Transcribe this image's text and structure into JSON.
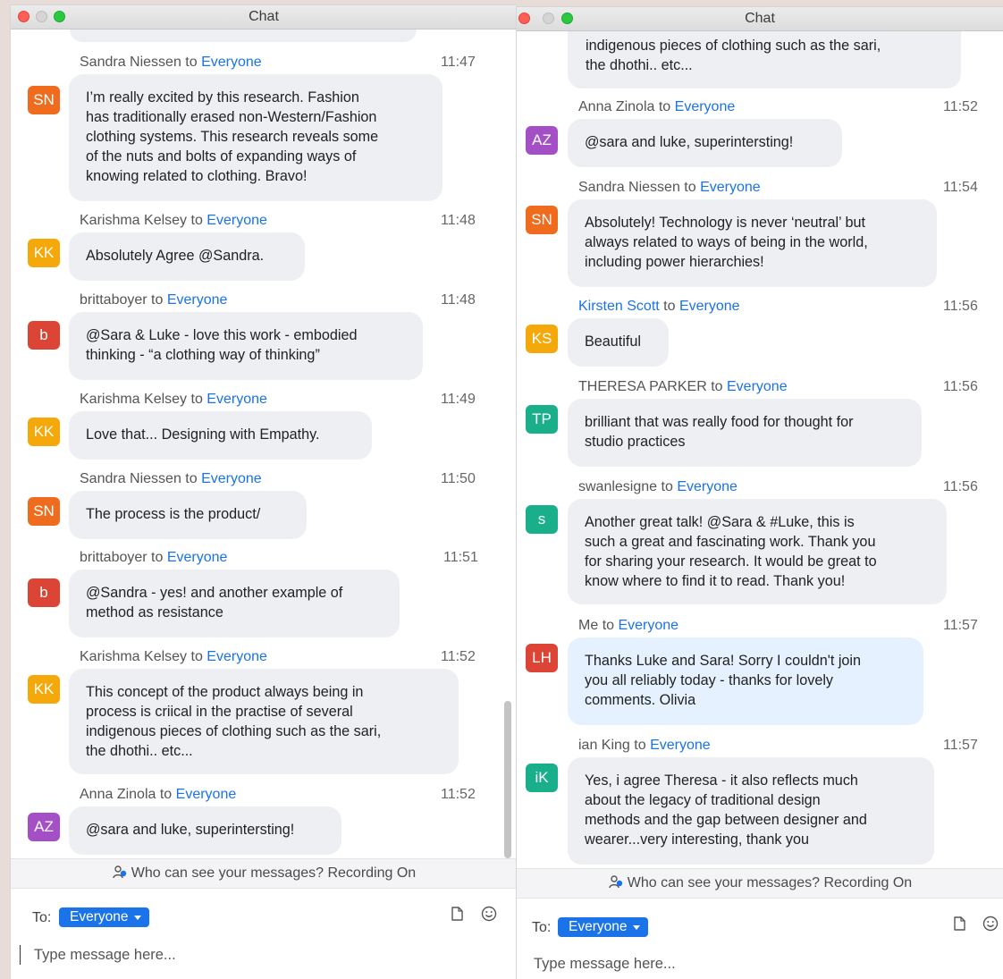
{
  "window_title": "Chat",
  "colors": {
    "orange": "#ef6c1e",
    "yellow": "#f5a80a",
    "red": "#dc4535",
    "purple": "#a54fc7",
    "teal": "#1aaf8b",
    "link_blue": "#1a73e8"
  },
  "left": {
    "messages": [
      {
        "sender": "Sandra Niessen",
        "to": "to",
        "recipient": "Everyone",
        "time": "11:47",
        "initials": "SN",
        "lines": [
          "I’m really excited by this research. Fashion",
          "has traditionally erased non-Western/Fashion",
          "clothing systems. This research reveals some",
          "of the nuts and bolts of expanding ways of",
          "knowing related to clothing. Bravo!"
        ]
      },
      {
        "sender": "Karishma Kelsey",
        "to": "to",
        "recipient": "Everyone",
        "time": "11:48",
        "initials": "KK",
        "lines": [
          "Absolutely Agree @Sandra."
        ]
      },
      {
        "sender": "brittaboyer",
        "to": "to",
        "recipient": "Everyone",
        "time": "11:48",
        "initials": "b",
        "lines": [
          "@Sara & Luke  - love this work - embodied",
          "thinking - “a clothing way of thinking”"
        ]
      },
      {
        "sender": "Karishma Kelsey",
        "to": "to",
        "recipient": "Everyone",
        "time": "11:49",
        "initials": "KK",
        "lines": [
          "Love that... Designing with Empathy."
        ]
      },
      {
        "sender": "Sandra Niessen",
        "to": "to",
        "recipient": "Everyone",
        "time": "11:50",
        "initials": "SN",
        "lines": [
          "The process is the product/"
        ]
      },
      {
        "sender": "brittaboyer",
        "to": "to",
        "recipient": "Everyone",
        "time": "11:51",
        "initials": "b",
        "lines": [
          "@Sandra - yes! and another example of",
          "method as resistance"
        ]
      },
      {
        "sender": "Karishma Kelsey",
        "to": "to",
        "recipient": "Everyone",
        "time": "11:52",
        "initials": "KK",
        "lines": [
          "This concept of the product always being in",
          "process is criical in the practise of several",
          "indigenous pieces of clothing such as the sari,",
          "the dhothi.. etc..."
        ]
      },
      {
        "sender": "Anna Zinola",
        "to": "to",
        "recipient": "Everyone",
        "time": "11:52",
        "initials": "AZ",
        "lines": [
          "@sara and luke, superintersting!"
        ]
      }
    ],
    "notice": "Who can see your messages? Recording On",
    "to_label": "To:",
    "to_value": "Everyone",
    "placeholder": "Type message here..."
  },
  "right": {
    "top_clipped_lines": [
      "indigenous pieces of clothing such as the sari,",
      "the dhothi.. etc..."
    ],
    "messages": [
      {
        "sender": "Anna Zinola",
        "to": "to",
        "recipient": "Everyone",
        "time": "11:52",
        "initials": "AZ",
        "lines": [
          "@sara and luke, superintersting!"
        ]
      },
      {
        "sender": "Sandra Niessen",
        "to": "to",
        "recipient": "Everyone",
        "time": "11:54",
        "initials": "SN",
        "lines": [
          "Absolutely! Technology is never ‘neutral’ but",
          "always related to ways of being in the world,",
          "including power hierarchies!"
        ]
      },
      {
        "sender": "Kirsten Scott",
        "to": "to",
        "recipient": "Everyone",
        "time": "11:56",
        "initials": "KS",
        "lines": [
          "Beautiful"
        ]
      },
      {
        "sender": "THERESA PARKER",
        "to": "to",
        "recipient": "Everyone",
        "time": "11:56",
        "initials": "TP",
        "lines": [
          "brilliant that was really food for thought for",
          "studio practices"
        ]
      },
      {
        "sender": "swanlesigne",
        "to": "to",
        "recipient": "Everyone",
        "time": "11:56",
        "initials": "s",
        "lines": [
          "Another great talk! @Sara & #Luke, this is",
          "such a great and fascinating work. Thank you",
          "for sharing your research. It would be great to",
          "know where to find it to read. Thank you!"
        ]
      },
      {
        "sender": "Me",
        "to": "to",
        "recipient": "Everyone",
        "time": "11:57",
        "initials": "LH",
        "lines": [
          "Thanks Luke and Sara! Sorry I couldn't join",
          "you all reliably today - thanks for lovely",
          "comments. Olivia"
        ]
      },
      {
        "sender": "ian King",
        "to": "to",
        "recipient": "Everyone",
        "time": "11:57",
        "initials": "iK",
        "lines": [
          "Yes, i agree Theresa - it also reflects much",
          "about the legacy of traditional design",
          "methods and the gap between designer and",
          "wearer...very interesting, thank you"
        ]
      }
    ],
    "notice": "Who can see your messages? Recording On",
    "to_label": "To:",
    "to_value": "Everyone",
    "placeholder": "Type message here..."
  }
}
